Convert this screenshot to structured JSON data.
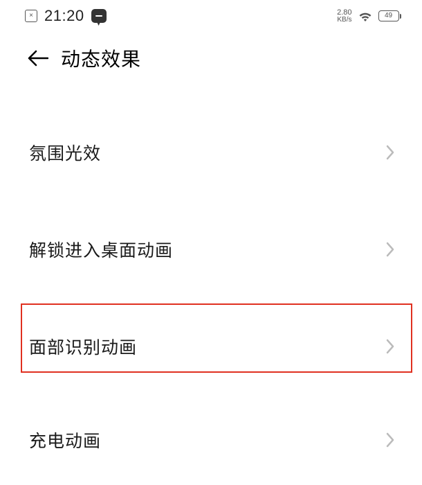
{
  "status": {
    "time": "21:20",
    "kbps_value": "2.80",
    "kbps_unit": "KB/s",
    "battery_level": "49"
  },
  "header": {
    "title": "动态效果"
  },
  "menu": {
    "items": [
      {
        "label": "氛围光效"
      },
      {
        "label": "解锁进入桌面动画"
      },
      {
        "label": "面部识别动画"
      },
      {
        "label": "充电动画"
      }
    ]
  }
}
